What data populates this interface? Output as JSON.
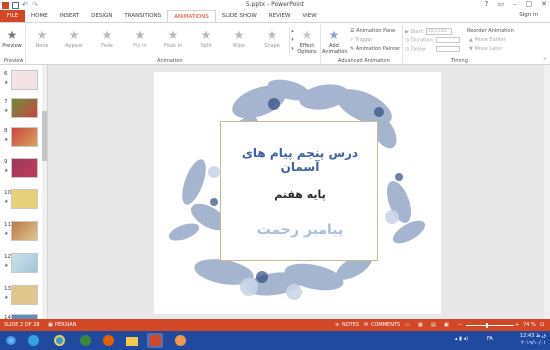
{
  "window": {
    "title": "5.pptx - PowerPoint",
    "signin": "Sign in"
  },
  "tabs": [
    "FILE",
    "HOME",
    "INSERT",
    "DESIGN",
    "TRANSITIONS",
    "ANIMATIONS",
    "SLIDE SHOW",
    "REVIEW",
    "VIEW"
  ],
  "ribbon": {
    "preview": "Preview",
    "animations": [
      "None",
      "Appear",
      "Fade",
      "Fly In",
      "Float In",
      "Split",
      "Wipe",
      "Shape"
    ],
    "effect_options": "Effect Options",
    "add_animation": "Add Animation",
    "animation_pane": "Animation Pane",
    "trigger": "Trigger",
    "animation_painter": "Animation Painter",
    "start_label": "Start:",
    "start_value": "On Click",
    "duration_label": "Duration:",
    "delay_label": "Delay:",
    "reorder": "Reorder Animation",
    "move_earlier": "Move Earlier",
    "move_later": "Move Later",
    "groups": {
      "preview": "Preview",
      "animation": "Animation",
      "advanced": "Advanced Animation",
      "timing": "Timing"
    }
  },
  "thumbnails": [
    {
      "num": "6",
      "color": "#f3e4e4"
    },
    {
      "num": "7",
      "color": "#c8463e"
    },
    {
      "num": "8",
      "color": "#d9a35c"
    },
    {
      "num": "9",
      "color": "#9b3a5a"
    },
    {
      "num": "10",
      "color": "#e7d07a"
    },
    {
      "num": "11",
      "color": "#b87a4a"
    },
    {
      "num": "12",
      "color": "#cfe2ea"
    },
    {
      "num": "13",
      "color": "#e3c68e"
    },
    {
      "num": "14",
      "color": "#5b8fc0"
    }
  ],
  "slide": {
    "line1": "درس پنجم پیام های آسمان",
    "line2": "پایه هفتم",
    "line3": "پیامبر رحمت"
  },
  "status": {
    "slide": "SLIDE 2 OF 28",
    "lang": "PERSIAN",
    "notes": "NOTES",
    "comments": "COMMENTS",
    "zoom": "74 %"
  },
  "tray": {
    "lang": "FA",
    "time": "12:43 ق.ظ",
    "date": "۲۰۱۹/۱۰/۰۱"
  }
}
